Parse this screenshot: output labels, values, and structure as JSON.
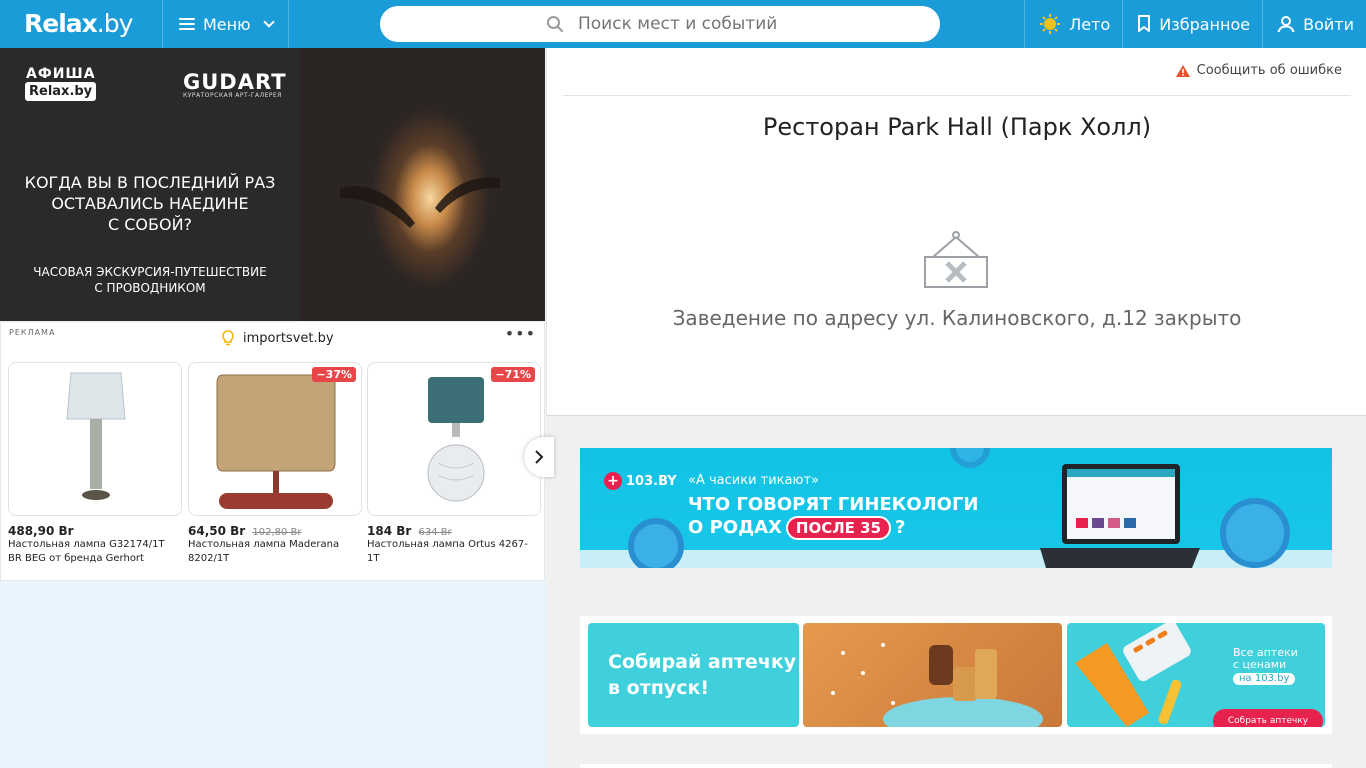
{
  "header": {
    "logo": "Relax",
    "logo_suffix": ".by",
    "menu_label": "Меню",
    "search_placeholder": "Поиск мест и событий",
    "season_label": "Лето",
    "favorites_label": "Избранное",
    "login_label": "Войти",
    "brand_color": "#1a9cd8"
  },
  "left_banner": {
    "afisha": "АФИША",
    "afisha_badge": "Relax.by",
    "gudart": "GUDART",
    "gudart_sub": "КУРАТОРСКАЯ АРТ-ГАЛЕРЕЯ",
    "title_lines": [
      "КОГДА ВЫ В ПОСЛЕДНИЙ РАЗ",
      "ОСТАВАЛИСЬ НАЕДИНЕ",
      "С СОБОЙ?"
    ],
    "sub_lines": [
      "ЧАСОВАЯ ЭКСКУРСИЯ-ПУТЕШЕСТВИЕ",
      "С ПРОВОДНИКОМ"
    ]
  },
  "ad": {
    "label": "РЕКЛАМА",
    "source": "importsvet.by",
    "products": [
      {
        "price": "488,90 Br",
        "old_price": "",
        "discount": "",
        "name": "Настольная лампа G32174/1T BR BEG от бренда Gerhort"
      },
      {
        "price": "64,50 Br",
        "old_price": "102,80 Br",
        "discount": "−37%",
        "name": "Настольная лампа Maderana 8202/1T"
      },
      {
        "price": "184 Br",
        "old_price": "634 Br",
        "discount": "−71%",
        "name": "Настольная лампа Ortus 4267-1T"
      }
    ]
  },
  "place": {
    "report": "Сообщить об ошибке",
    "title": "Ресторан Park Hall (Парк Холл)",
    "closed_text": "Заведение по адресу ул. Калиновского, д.12 закрыто"
  },
  "promo1": {
    "brand": "103.BY",
    "tag": "«А часики тикают»",
    "line1": "ЧТО ГОВОРЯТ ГИНЕКОЛОГИ",
    "line2_a": "О РОДАХ",
    "line2_pill": "ПОСЛЕ 35",
    "line2_b": "?"
  },
  "promo2": {
    "headline_lines": [
      "Собирай аптечку",
      "в отпуск!"
    ],
    "side_lines": [
      "Все аптеки",
      "с ценами"
    ],
    "side_badge": "на 103.by",
    "cta": "Собрать аптечку"
  }
}
